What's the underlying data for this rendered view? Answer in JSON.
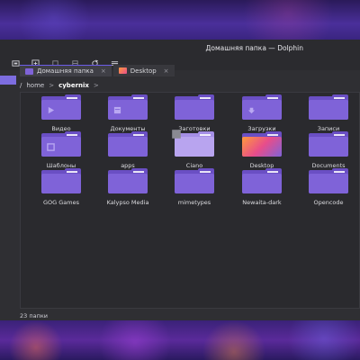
{
  "window": {
    "title": "Домашняя папка — Dolphin"
  },
  "toolbar": {
    "buttons": [
      "icons-view-icon",
      "new-tab-icon",
      "grid-icon",
      "compact-icon",
      "refresh-icon",
      "menu-icon"
    ]
  },
  "tabs": [
    {
      "label": "Домашняя папка",
      "close": "×"
    },
    {
      "label": "Desktop",
      "close": "×"
    }
  ],
  "breadcrumb": {
    "root": "/",
    "home": "home",
    "current": "cybernix"
  },
  "items": [
    {
      "label": "Видео",
      "glyph": "video"
    },
    {
      "label": "Документы",
      "glyph": "document"
    },
    {
      "label": "Заготовки",
      "glyph": "none"
    },
    {
      "label": "Загрузки",
      "glyph": "download"
    },
    {
      "label": "Записи",
      "glyph": "none"
    },
    {
      "label": "Шаблоны",
      "glyph": "template"
    },
    {
      "label": "apps",
      "glyph": "none"
    },
    {
      "label": "Ciano",
      "glyph": "light"
    },
    {
      "label": "Desktop",
      "glyph": "desktop"
    },
    {
      "label": "Documents",
      "glyph": "none"
    },
    {
      "label": "GOG Games",
      "glyph": "none"
    },
    {
      "label": "Kalypso Media",
      "glyph": "none"
    },
    {
      "label": "mimetypes",
      "glyph": "none"
    },
    {
      "label": "Newaita-dark",
      "glyph": "none"
    },
    {
      "label": "Opencode",
      "glyph": "none"
    }
  ],
  "status": {
    "text": "23 папки"
  },
  "colors": {
    "accent": "#7f63d8",
    "folder": "#7f63d8",
    "background": "#2a2a2e"
  }
}
